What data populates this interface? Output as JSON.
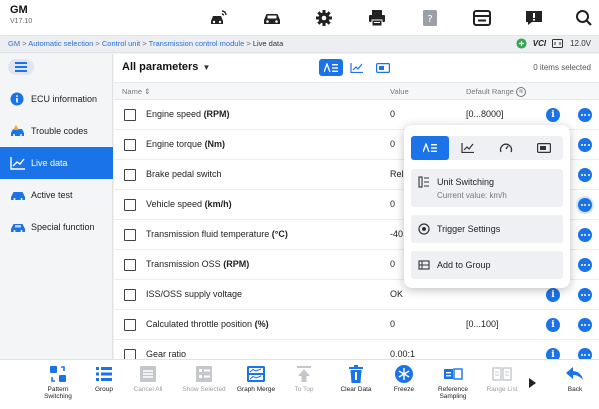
{
  "header": {
    "brand": "GM",
    "version": "V17.10",
    "icons": [
      "car-connect-icon",
      "car-icon",
      "gear-icon",
      "printer-icon",
      "help-doc-icon",
      "save-icon",
      "feedback-icon",
      "search-icon"
    ]
  },
  "breadcrumb": {
    "items": [
      "GM",
      "Automatic selection",
      "Control unit",
      "Transmission control module",
      "Live data"
    ],
    "separator": ">"
  },
  "status": {
    "vci_label": "VCI",
    "voltage": "12.0V"
  },
  "sidebar": {
    "items": [
      {
        "label": "ECU information",
        "icon": "info-icon",
        "active": false
      },
      {
        "label": "Trouble codes",
        "icon": "car-warning-icon",
        "active": false
      },
      {
        "label": "Live data",
        "icon": "line-chart-icon",
        "active": true
      },
      {
        "label": "Active test",
        "icon": "car-test-icon",
        "active": false
      },
      {
        "label": "Special function",
        "icon": "car-special-icon",
        "active": false
      }
    ]
  },
  "main": {
    "filter_label": "All parameters",
    "items_selected": "0 items selected",
    "columns": {
      "name": "Name",
      "value": "Value",
      "range": "Default Range"
    },
    "rows": [
      {
        "name": "Engine speed",
        "unit": "(RPM)",
        "value": "0",
        "range": "[0...8000]",
        "info": true
      },
      {
        "name": "Engine torque",
        "unit": "(Nm)",
        "value": "0",
        "range": "",
        "info": false
      },
      {
        "name": "Brake pedal switch",
        "unit": "",
        "value": "Rel",
        "range": "",
        "info": false
      },
      {
        "name": "Vehicle speed",
        "unit": "(km/h)",
        "value": "0",
        "range": "",
        "info": false
      },
      {
        "name": "Transmission fluid temperature",
        "unit": "(°C)",
        "value": "-40",
        "range": "",
        "info": false
      },
      {
        "name": "Transmission OSS",
        "unit": "(RPM)",
        "value": "0",
        "range": "",
        "info": false
      },
      {
        "name": "ISS/OSS supply voltage",
        "unit": "",
        "value": "OK",
        "range": "",
        "info": true
      },
      {
        "name": "Calculated throttle position",
        "unit": "(%)",
        "value": "0",
        "range": "[0...100]",
        "info": true
      },
      {
        "name": "Gear ratio",
        "unit": "",
        "value": "0.00:1",
        "range": "",
        "info": true
      }
    ]
  },
  "popup": {
    "tabs": [
      "text-view-icon",
      "line-graph-icon",
      "gauge-icon",
      "digital-view-icon"
    ],
    "unit_switching": "Unit Switching",
    "current_value": "Current value: km/h",
    "trigger_settings": "Trigger Settings",
    "add_to_group": "Add to Group"
  },
  "toolbar": {
    "items": [
      {
        "label": "Pattern Switching",
        "enabled": true
      },
      {
        "label": "Group",
        "enabled": true
      },
      {
        "label": "Cancel All",
        "enabled": false
      },
      {
        "label": "Show Selected",
        "enabled": false
      },
      {
        "label": "Graph Merge",
        "enabled": true
      },
      {
        "label": "To Top",
        "enabled": false
      },
      {
        "label": "Clear Data",
        "enabled": true
      },
      {
        "label": "Freeze",
        "enabled": true
      },
      {
        "label": "Reference Sampling",
        "enabled": true
      },
      {
        "label": "Range List",
        "enabled": false
      },
      {
        "label": "Back",
        "enabled": true
      }
    ]
  },
  "colors": {
    "accent": "#1a73e8",
    "disabled": "#9aa0a6"
  }
}
